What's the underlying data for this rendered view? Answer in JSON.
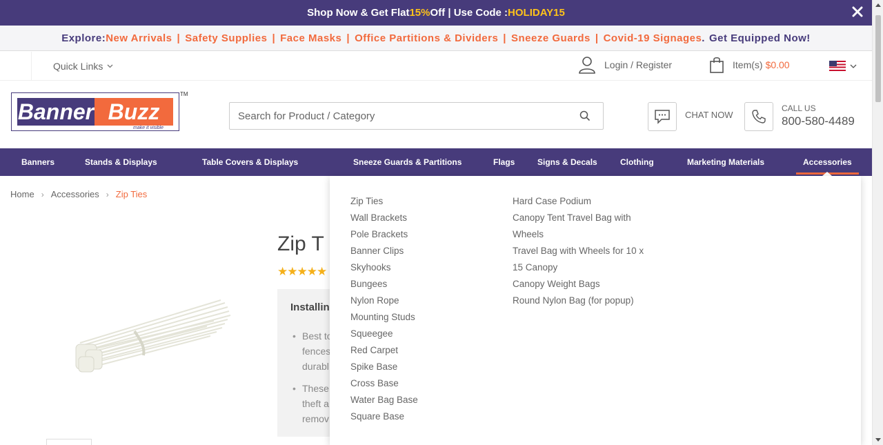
{
  "promo": {
    "text1": "Shop Now & Get Flat ",
    "discount": "15%",
    "text2": " Off | Use Code : ",
    "code": "HOLIDAY15"
  },
  "explore": {
    "label": "Explore: ",
    "links": [
      "New Arrivals",
      "Safety Supplies",
      "Face Masks",
      "Office Partitions & Dividers",
      "Sneeze Guards",
      "Covid-19 Signages"
    ],
    "period": ".",
    "cta": "Get Equipped Now!"
  },
  "util": {
    "quick_links": "Quick Links",
    "login": "Login / Register",
    "items": "Item(s)",
    "amount": "$0.00"
  },
  "logo": {
    "left": "Banner",
    "right": "Buzz",
    "tagline": "make it visible",
    "tm": "TM"
  },
  "search": {
    "placeholder": "Search for Product / Category"
  },
  "contact": {
    "chat": "CHAT NOW",
    "call_label": "CALL US",
    "phone": "800-580-4489"
  },
  "nav": {
    "items": [
      "Banners",
      "Stands & Displays",
      "Table Covers & Displays",
      "Sneeze Guards & Partitions",
      "Flags",
      "Signs & Decals",
      "Clothing",
      "Marketing Materials",
      "Accessories"
    ],
    "active": "Accessories"
  },
  "breadcrumb": [
    "Home",
    "Accessories",
    "Zip Ties"
  ],
  "product": {
    "title": "Zip T",
    "stars": "★★★★★",
    "info_heading": "Installing",
    "bullet1": [
      "Best to",
      "fences",
      "durabl"
    ],
    "bullet2": [
      "These",
      "theft a",
      "remov"
    ]
  },
  "dropdown": {
    "col1": [
      "Zip Ties",
      "Wall Brackets",
      "Pole Brackets",
      "Banner Clips",
      "Skyhooks",
      "Bungees",
      "Nylon Rope",
      "Mounting Studs",
      "Squeegee",
      "Red Carpet",
      "Spike Base",
      "Cross Base",
      "Water Bag Base",
      "Square Base"
    ],
    "col2": [
      "Hard Case Podium",
      "Canopy Tent Travel Bag with",
      "Wheels",
      "Travel Bag with Wheels for 10 x",
      "15 Canopy",
      "Canopy Weight Bags",
      "Round Nylon Bag (for popup)"
    ]
  },
  "colors": {
    "brand": "#473b7b",
    "accent": "#f26a3d",
    "promo_highlight": "#ffc31a"
  }
}
